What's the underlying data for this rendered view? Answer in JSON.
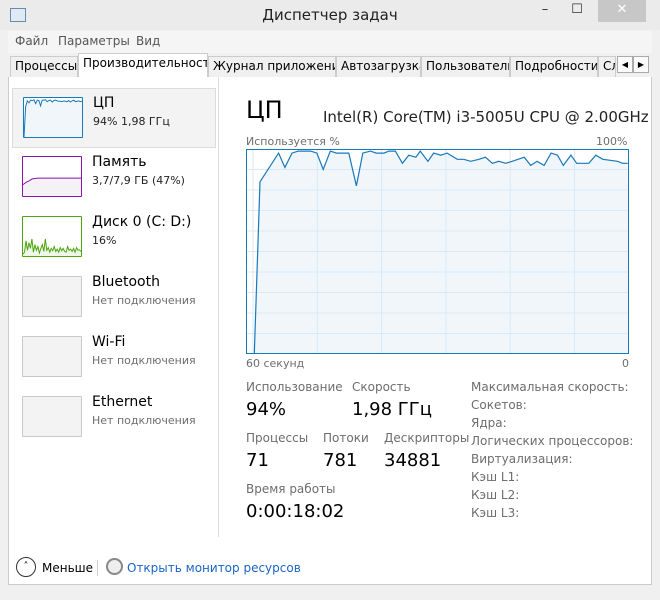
{
  "window": {
    "title": "Диспетчер задач",
    "minimize": "–",
    "maximize": "☐",
    "close": "✕"
  },
  "menu": [
    "Файл",
    "Параметры",
    "Вид"
  ],
  "tabs": [
    "Процессы",
    "Производительность",
    "Журнал приложений",
    "Автозагрузка",
    "Пользователи",
    "Подробности",
    "Службы"
  ],
  "active_tab": 1,
  "tab_scroll": {
    "left": "◀",
    "right": "▶"
  },
  "sidebar": [
    {
      "name": "ЦП",
      "sub": "94%  1,98 ГГц",
      "color": "#1779ba",
      "spark": [
        0,
        80,
        95,
        90,
        97,
        96,
        98,
        88,
        97,
        96,
        82,
        97,
        97,
        98,
        93,
        96,
        97,
        92,
        96,
        97,
        95,
        94,
        94,
        93,
        95,
        94,
        93,
        96,
        92,
        95,
        97,
        93,
        94,
        95,
        93,
        94
      ]
    },
    {
      "name": "Память",
      "sub": "3,7/7,9 ГБ (47%)",
      "color": "#8b12ae",
      "spark": [
        30,
        36,
        40,
        45,
        46,
        47,
        47,
        47,
        47,
        47,
        47,
        47,
        47,
        47,
        47,
        47,
        47,
        47,
        47,
        47
      ]
    },
    {
      "name": "Диск 0 (C: D:)",
      "sub": "16%",
      "color": "#4da60c",
      "spark": [
        5,
        10,
        40,
        15,
        35,
        20,
        45,
        10,
        30,
        15,
        25,
        8,
        20,
        30,
        12,
        45,
        15,
        22,
        10,
        20,
        14,
        25,
        12,
        18,
        10,
        22,
        14,
        20,
        12,
        10,
        25,
        15,
        18,
        12,
        20,
        10,
        22,
        15,
        16,
        12
      ]
    },
    {
      "name": "Bluetooth",
      "sub": "Нет подключения"
    },
    {
      "name": "Wi-Fi",
      "sub": "Нет подключения"
    },
    {
      "name": "Ethernet",
      "sub": "Нет подключения"
    }
  ],
  "main": {
    "title": "ЦП",
    "model": "Intel(R) Core(TM) i3-5005U CPU @ 2.00GHz",
    "stats": {
      "usage_label": "Использование",
      "usage": "94%",
      "speed_label": "Скорость",
      "speed": "1,98 ГГц",
      "processes_label": "Процессы",
      "processes": "71",
      "threads_label": "Потоки",
      "threads": "781",
      "handles_label": "Дескрипторы",
      "handles": "34881",
      "uptime_label": "Время работы",
      "uptime": "0:00:18:02"
    },
    "info": [
      "Максимальная скорость:",
      "Сокетов:",
      "Ядра:",
      "Логических процессоров:",
      "Виртуализация:",
      "Кэш L1:",
      "Кэш L2:",
      "Кэш L3:"
    ]
  },
  "chart_data": {
    "type": "area",
    "ylabel": "Используется %",
    "ymax_label": "100%",
    "xlabel_left": "60 секунд",
    "xlabel_right": "0",
    "xlim": [
      60,
      0
    ],
    "ylim": [
      0,
      100
    ],
    "grid": true,
    "color": "#1779ba",
    "fill": "#f1f6fb",
    "points": [
      [
        60,
        0
      ],
      [
        58.7,
        0
      ],
      [
        57.8,
        84
      ],
      [
        54.9,
        98
      ],
      [
        53.9,
        91
      ],
      [
        52.8,
        98
      ],
      [
        51.8,
        99
      ],
      [
        49.9,
        99
      ],
      [
        48.9,
        98
      ],
      [
        47.9,
        90
      ],
      [
        46.8,
        99
      ],
      [
        45.8,
        98
      ],
      [
        43.9,
        98
      ],
      [
        42.7,
        82
      ],
      [
        41.7,
        98
      ],
      [
        40.5,
        99
      ],
      [
        39.6,
        98
      ],
      [
        38.4,
        98
      ],
      [
        37.6,
        99
      ],
      [
        36.6,
        99
      ],
      [
        35.5,
        93
      ],
      [
        34.5,
        97
      ],
      [
        33.4,
        96
      ],
      [
        32.7,
        99
      ],
      [
        31.5,
        94
      ],
      [
        30.6,
        98
      ],
      [
        29.5,
        97
      ],
      [
        28.5,
        98
      ],
      [
        26.9,
        95
      ],
      [
        25.9,
        95
      ],
      [
        24.8,
        94
      ],
      [
        23.5,
        95
      ],
      [
        22.5,
        96
      ],
      [
        21.4,
        93
      ],
      [
        20.4,
        94
      ],
      [
        19.3,
        93
      ],
      [
        18.3,
        94
      ],
      [
        16.4,
        96
      ],
      [
        15.4,
        92
      ],
      [
        14.4,
        94
      ],
      [
        13.3,
        92
      ],
      [
        12.2,
        98
      ],
      [
        11.2,
        97
      ],
      [
        10.3,
        92
      ],
      [
        9.1,
        97
      ],
      [
        8.2,
        93
      ],
      [
        7.3,
        93
      ],
      [
        6.3,
        93
      ],
      [
        5.2,
        97
      ],
      [
        4.1,
        95
      ],
      [
        1.8,
        94
      ],
      [
        1.0,
        93
      ],
      [
        0.2,
        93
      ]
    ]
  },
  "footer": {
    "less_icon": "˄",
    "less": "Меньше",
    "resmon": "Открыть монитор ресурсов"
  }
}
